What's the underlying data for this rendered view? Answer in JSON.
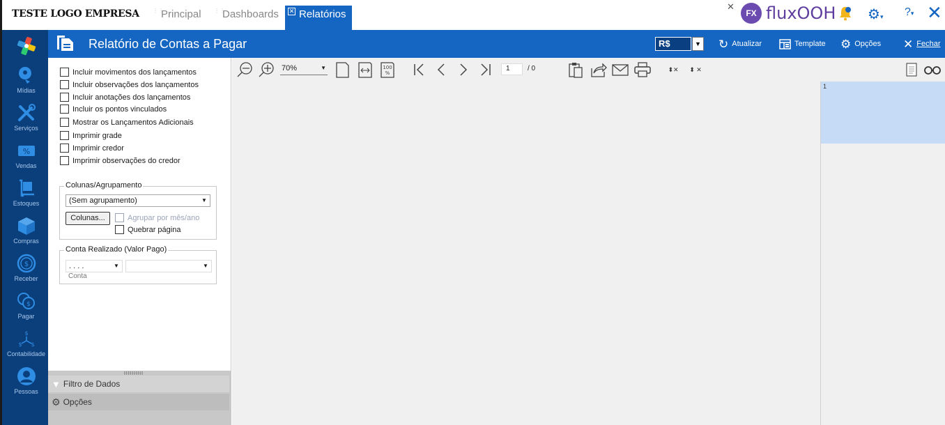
{
  "brand": "TESTE LOGO EMPRESA",
  "tabs": [
    {
      "label": "Principal",
      "active": false
    },
    {
      "label": "Dashboards",
      "active": false
    },
    {
      "label": "Relatórios",
      "active": true
    }
  ],
  "topright": {
    "product_name": "fluxOOH",
    "product_badge": "FX",
    "help_label": "?"
  },
  "header": {
    "title": "Relatório de Contas a Pagar",
    "currency": "R$",
    "actions": {
      "refresh": "Atualizar",
      "template": "Template",
      "options": "Opções",
      "close": "Fechar"
    }
  },
  "nav": [
    "Mídias",
    "Serviços",
    "Vendas",
    "Estoques",
    "Compras",
    "Receber",
    "Pagar",
    "Contabilidade",
    "Pessoas"
  ],
  "options": {
    "checkboxes": [
      "Incluir movimentos dos lançamentos",
      "Incluir observações dos lançamentos",
      "Incluir anotações dos lançamentos",
      "Incluir os pontos vinculados",
      "Mostrar os Lançamentos Adicionais",
      "Imprimir grade",
      "Imprimir credor",
      "Imprimir observações do credor"
    ],
    "grouping": {
      "legend": "Colunas/Agrupamento",
      "value": "(Sem agrupamento)",
      "columns_button": "Colunas...",
      "group_month": "Agrupar por mês/ano",
      "page_break": "Quebrar página"
    },
    "account": {
      "legend": "Conta Realizado (Valor Pago)",
      "mask": ". . . .",
      "caption": "Conta"
    }
  },
  "bottom_tabs": {
    "filter": "Filtro de Dados",
    "options": "Opções"
  },
  "preview": {
    "zoom": "70%",
    "page": "1",
    "page_total": "/ 0",
    "thumb_label": "1"
  }
}
